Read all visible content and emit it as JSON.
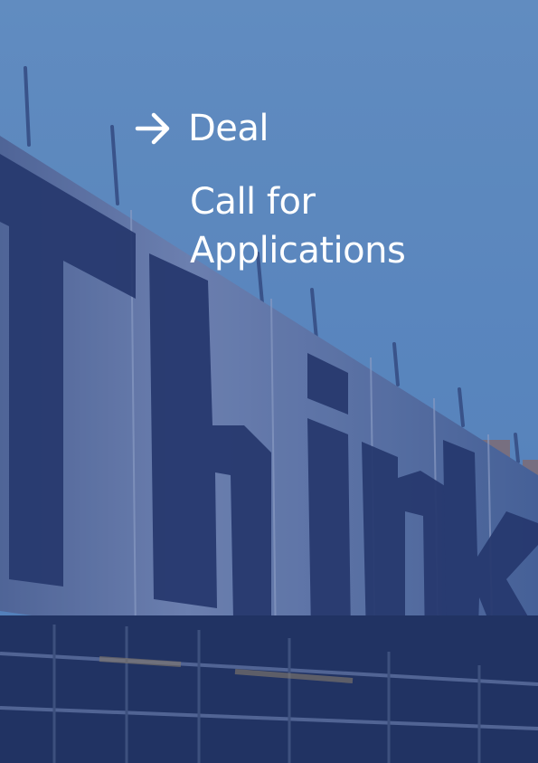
{
  "cover": {
    "label": "Deal",
    "title": "Call for\nApplications",
    "banner_word": "Think",
    "arrow_icon": "arrow-right-icon"
  },
  "colors": {
    "sky": "#6a9ccf",
    "overlay": "#1f3a7a",
    "text": "#ffffff"
  }
}
